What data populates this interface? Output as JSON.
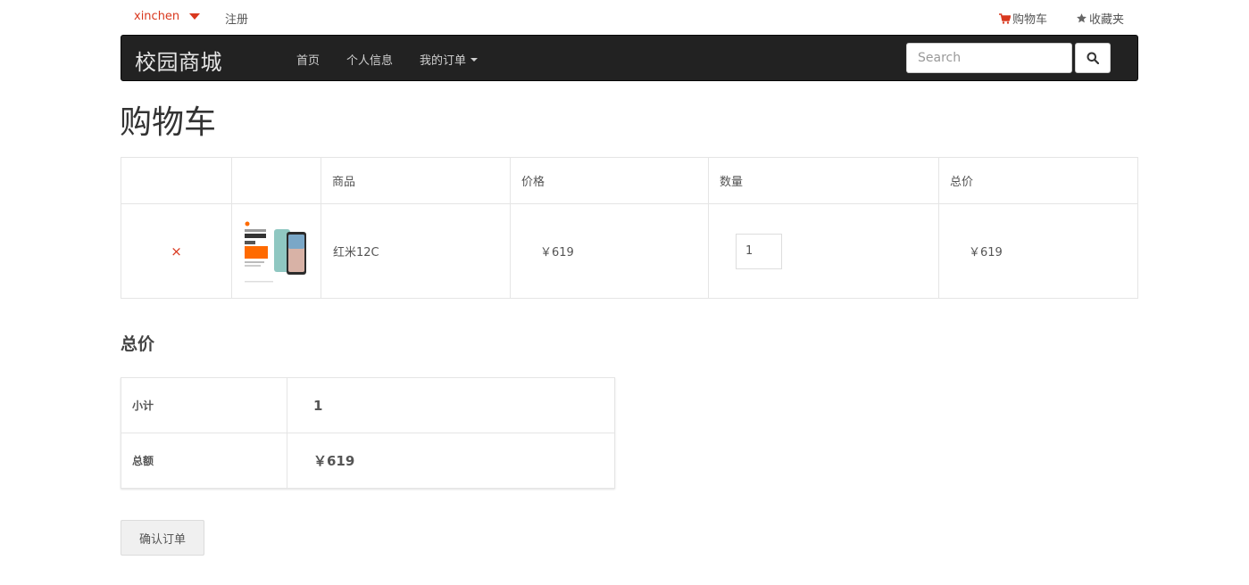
{
  "topbar": {
    "user_label": "xinchen",
    "register_label": "注册",
    "cart_label": "购物车",
    "favorites_label": "收藏夹",
    "accent_color": "#d9381e"
  },
  "navbar": {
    "brand": "校园商城",
    "items": [
      {
        "label": "首页"
      },
      {
        "label": "个人信息"
      },
      {
        "label": "我的订单"
      }
    ],
    "search_placeholder": "Search",
    "background_color": "#222222"
  },
  "page": {
    "title": "购物车"
  },
  "cart": {
    "headers": [
      "",
      "",
      "商品",
      "价格",
      "数量",
      "总价"
    ],
    "rows": [
      {
        "remove_icon": "×",
        "product_name": "红米12C",
        "price": "￥619",
        "quantity": "1",
        "total": "￥619"
      }
    ]
  },
  "totals": {
    "title": "总价",
    "subtotal_label": "小计",
    "subtotal_value": "1",
    "amount_label": "总额",
    "amount_value": "￥619"
  },
  "actions": {
    "confirm_label": "确认订单"
  }
}
